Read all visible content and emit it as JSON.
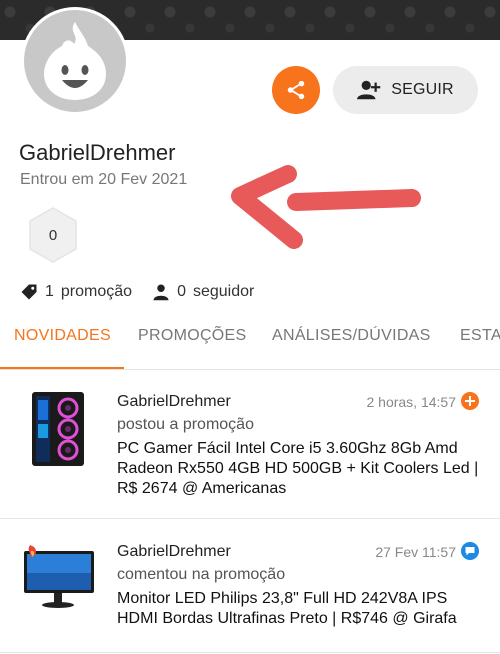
{
  "profile": {
    "username": "GabrielDrehmer",
    "joined": "Entrou em 20 Fev 2021",
    "level": "0",
    "avatar_icon": "flame-mascot-icon"
  },
  "actions": {
    "share_icon": "share-icon",
    "follow_label": "SEGUIR",
    "follow_icon": "add-user-icon",
    "accent_color": "#f7731c"
  },
  "stats": {
    "promotions_count": "1",
    "promotions_label": "promoção",
    "followers_count": "0",
    "followers_label": "seguidor"
  },
  "tabs": [
    {
      "label": "NOVIDADES",
      "active": true
    },
    {
      "label": "PROMOÇÕES",
      "active": false
    },
    {
      "label": "ANÁLISES/DÚVIDAS",
      "active": false
    },
    {
      "label": "ESTATÍSTICAS",
      "active": false
    }
  ],
  "feed": [
    {
      "author": "GabrielDrehmer",
      "time": "2 horas, 14:57",
      "time_icon": "plus-circle-icon",
      "action": "postou a promoção",
      "title": "PC Gamer Fácil Intel Core i5 3.60Ghz 8Gb Amd Radeon Rx550 4GB HD 500GB + Kit Coolers Led | R$ 2674 @ Americanas",
      "thumb_icon": "pc-tower-icon"
    },
    {
      "author": "GabrielDrehmer",
      "time": "27 Fev 11:57",
      "time_icon": "comment-icon",
      "action": "comentou na promoção",
      "title": "Monitor LED Philips 23,8\" Full HD 242V8A IPS HDMI Bordas Ultrafinas Preto | R$746 @ Girafa",
      "thumb_icon": "monitor-icon"
    }
  ]
}
